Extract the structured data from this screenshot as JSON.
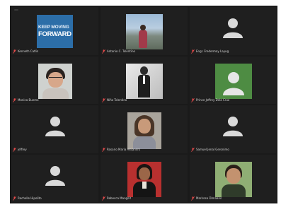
{
  "meeting": {
    "badge": "",
    "tiles": [
      {
        "name": "Kenneth Catlin",
        "kind": "poster",
        "poster": {
          "line1": "KEEP MOVING",
          "line2": "FORWARD"
        }
      },
      {
        "name": "Antonio C. Tolentino",
        "kind": "photo-outdoor"
      },
      {
        "name": "Engr. Fredermay Layug",
        "kind": "avatar"
      },
      {
        "name": "Monica Buemo",
        "kind": "photo-woman-glasses"
      },
      {
        "name": "Niño Tolentino",
        "kind": "photo-man-suit"
      },
      {
        "name": "Prince Jeffrey Dela Cruz",
        "kind": "avatar-green"
      },
      {
        "name": "jeffrey",
        "kind": "avatar"
      },
      {
        "name": "Rosario Maria Alejandro",
        "kind": "photo-woman-smile"
      },
      {
        "name": "Samuel Jenal Geronimo",
        "kind": "avatar"
      },
      {
        "name": "Rachelle Hipolito",
        "kind": "avatar"
      },
      {
        "name": "Rebecca Mangilit",
        "kind": "photo-woman-red"
      },
      {
        "name": "Marirose Dimaano",
        "kind": "photo-woman-green"
      }
    ]
  }
}
